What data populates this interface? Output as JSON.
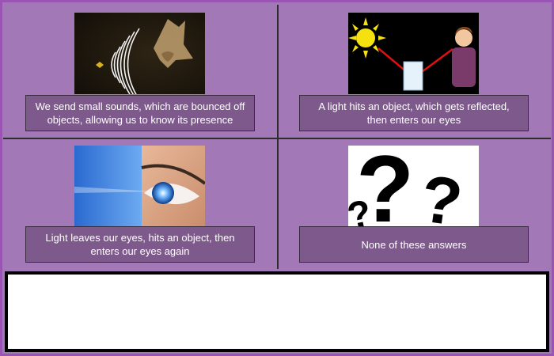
{
  "options": [
    {
      "image": "bat-echolocation-image",
      "text": "We send small sounds, which are bounced off objects, allowing us to know its presence"
    },
    {
      "image": "sun-reflection-image",
      "text": "A light hits an object, which gets reflected, then enters our eyes"
    },
    {
      "image": "eye-light-beam-image",
      "text": "Light leaves our eyes, hits an object, then enters our eyes again"
    },
    {
      "image": "question-marks-image",
      "text": "None of these answers"
    }
  ],
  "feedback": {
    "text": ""
  },
  "colors": {
    "background": "#a378b6",
    "answer_box": "#7e5a8c",
    "answer_text": "#ffffff",
    "divider": "#2d2d2d"
  }
}
